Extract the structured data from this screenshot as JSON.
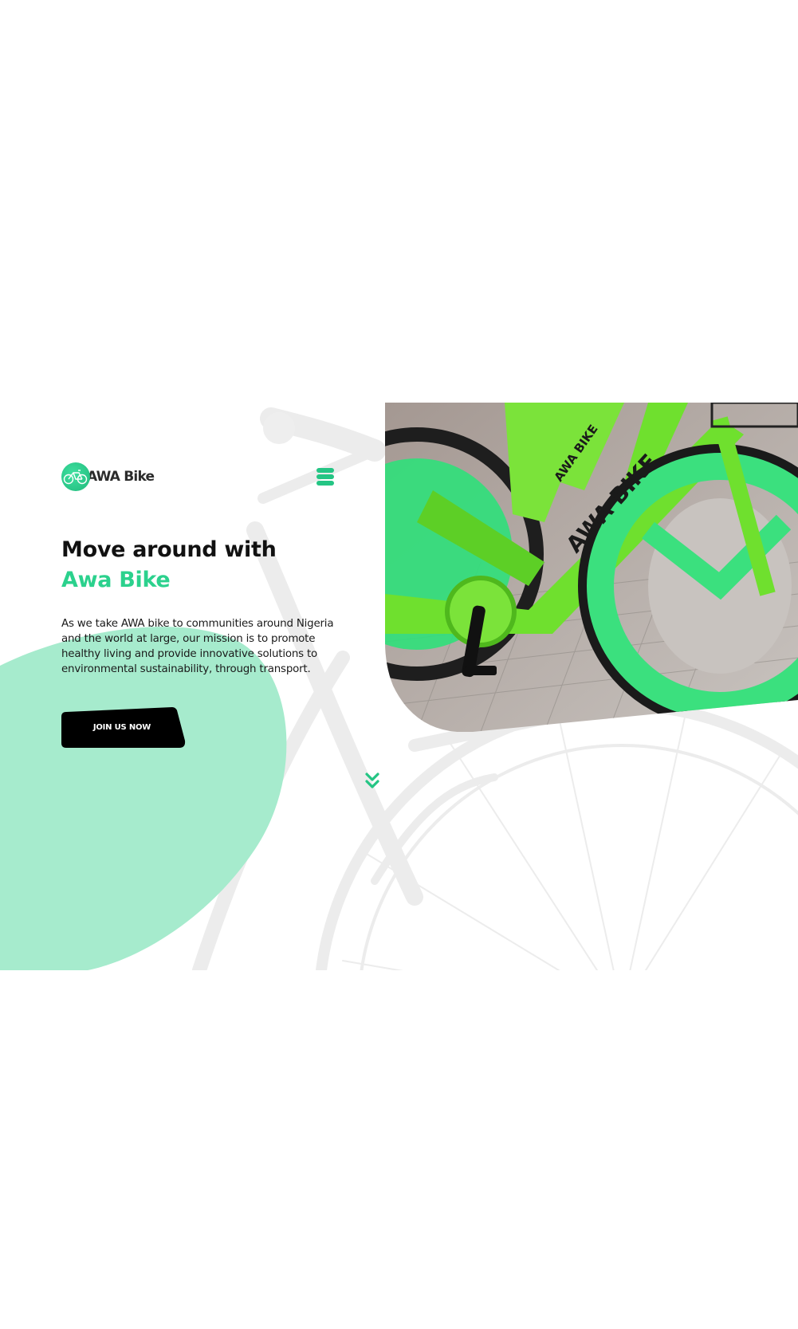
{
  "brand": {
    "name": "AWA Bike",
    "logo_icon": "bicycle-logo-icon",
    "accent_color": "#2bd18d",
    "blob_color": "#a6ebcd",
    "button_color": "#000000"
  },
  "nav": {
    "menu_icon": "hamburger-menu-icon"
  },
  "hero": {
    "headline_line1": "Move around with",
    "headline_line2": "Awa Bike",
    "description": "As we take AWA bike to communities around Nigeria and the world at large, our mission is to promote healthy living and provide innovative solutions to environmental sustainability, through transport.",
    "cta_label": "JOIN US NOW",
    "photo_subject": "green AWA BIKE bicycles parked on paved ground",
    "photo_bike_label": "AWA BIKE",
    "scroll_icon": "double-chevron-down-icon"
  }
}
